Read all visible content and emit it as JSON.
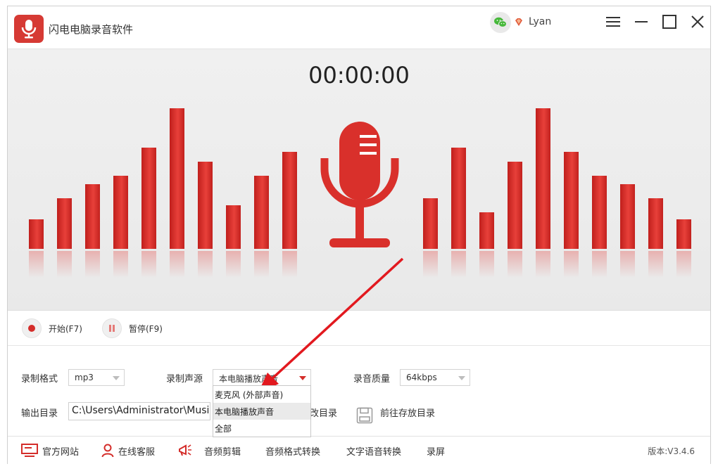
{
  "app": {
    "title": "闪电电脑录音软件",
    "user_name": "Lyan"
  },
  "colors": {
    "accent": "#d63a34",
    "bar_red": "#d9302b"
  },
  "timer": "00:00:00",
  "visualizer": {
    "bar_levels": [
      0.21,
      0.36,
      0.46,
      0.52,
      0.72,
      1.0,
      0.62,
      0.31,
      0.52,
      0.69,
      0.36,
      0.72,
      0.26,
      0.62,
      1.0,
      0.69,
      0.52,
      0.46,
      0.36,
      0.21
    ]
  },
  "controls": {
    "start_label": "开始(F7)",
    "pause_label": "暂停(F9)"
  },
  "settings": {
    "format_label": "录制格式",
    "format_value": "mp3",
    "source_label": "录制声源",
    "source_value": "本电脑播放声音",
    "source_options": [
      "麦克风 (外部声音)",
      "本电脑播放声音",
      "全部"
    ],
    "quality_label": "录音质量",
    "quality_value": "64kbps",
    "output_label": "输出目录",
    "output_path": "C:\\Users\\Administrator\\Music",
    "change_dir_label": "改目录",
    "open_dir_label": "前往存放目录"
  },
  "bottom_nav": {
    "website": "官方网站",
    "support": "在线客服",
    "audio_edit": "音频剪辑",
    "format_convert": "音频格式转换",
    "tts": "文字语音转换",
    "screen_record": "录屏",
    "version": "版本:V3.4.6"
  }
}
